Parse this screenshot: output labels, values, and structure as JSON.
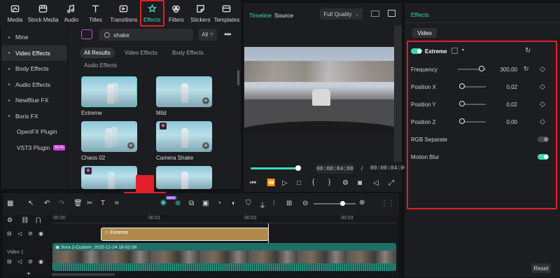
{
  "toolbar": {
    "tabs": [
      {
        "label": "Media",
        "icon": "media-icon"
      },
      {
        "label": "Stock Media",
        "icon": "stock-media-icon"
      },
      {
        "label": "Audio",
        "icon": "audio-icon"
      },
      {
        "label": "Titles",
        "icon": "titles-icon"
      },
      {
        "label": "Transitions",
        "icon": "transitions-icon"
      },
      {
        "label": "Effects",
        "icon": "effects-icon"
      },
      {
        "label": "Filters",
        "icon": "filters-icon"
      },
      {
        "label": "Stickers",
        "icon": "stickers-icon"
      },
      {
        "label": "Templates",
        "icon": "templates-icon"
      }
    ]
  },
  "sidebar": {
    "items": [
      {
        "label": "Mine",
        "arrow": "▸"
      },
      {
        "label": "Video Effects",
        "arrow": "▸"
      },
      {
        "label": "Body Effects",
        "arrow": "▸"
      },
      {
        "label": "Audio Effects",
        "arrow": "▸"
      },
      {
        "label": "NewBlue FX",
        "arrow": "▸"
      },
      {
        "label": "Boris FX",
        "arrow": "▸"
      },
      {
        "label": "OpenFX Plugin",
        "arrow": ""
      },
      {
        "label": "VST3 Plugin",
        "arrow": "",
        "badge": "BETA"
      }
    ]
  },
  "browser": {
    "search_value": "shake",
    "filter_label": "All",
    "chips": [
      "All Results",
      "Video Effects",
      "Body Effects",
      "Audio Effects"
    ],
    "cards": [
      {
        "label": "Extreme"
      },
      {
        "label": "Mild"
      },
      {
        "label": "Chaos 02"
      },
      {
        "label": "Camera Shake"
      }
    ]
  },
  "player": {
    "tab_timeline": "Timeline",
    "tab_source": "Source",
    "quality": "Full Quality",
    "current_time": "00:00:04:00",
    "separator": "/",
    "total_time": "00:00:04:00",
    "progress": 0.97
  },
  "effects_panel": {
    "title": "Effects",
    "tab": "Video",
    "effect_name": "Extreme",
    "params": [
      {
        "label": "Frequency",
        "value": "300,00",
        "fraction": 0.95
      },
      {
        "label": "Position X",
        "value": "0,02",
        "fraction": 0.0
      },
      {
        "label": "Position Y",
        "value": "0,02",
        "fraction": 0.0
      },
      {
        "label": "Position Z",
        "value": "0,00",
        "fraction": 0.0
      }
    ],
    "rgb_separate": {
      "label": "RGB Separate",
      "on": false
    },
    "motion_blur": {
      "label": "Motion Blur",
      "on": true
    },
    "reset_label": "Reset"
  },
  "timeline": {
    "ruler": [
      "00:00",
      "00:01",
      "00:02",
      "00:03"
    ],
    "effect_clip": "Extreme",
    "video_clip": "Sora 2-Custom_2025-12-24 18-02-56",
    "track_label": "Video 1",
    "zoom_badge": "NEW"
  },
  "colors": {
    "accent": "#3fd6b4",
    "highlight": "#e0202b",
    "clip_effect": "#b08a4a",
    "clip_video": "#1f6f67"
  }
}
